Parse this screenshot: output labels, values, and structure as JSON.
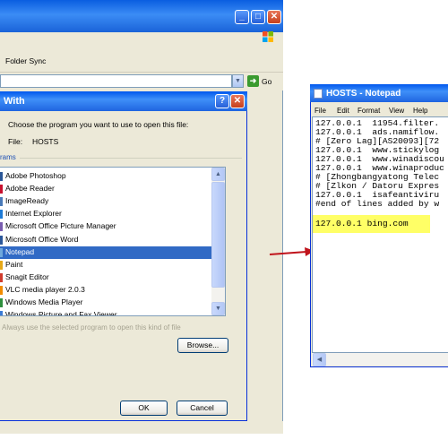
{
  "explorer": {
    "folder_sync_label": "Folder Sync",
    "go_label": "Go"
  },
  "open_with": {
    "title": "With",
    "help_glyph": "?",
    "close_glyph": "✕",
    "choose_text": "Choose the program you want to use to open this file:",
    "file_label": "File:",
    "file_name": "HOSTS",
    "programs_label": "rams",
    "programs": [
      {
        "label": "Adobe Photoshop",
        "icon": "photoshop-icon",
        "color": "#2b5797"
      },
      {
        "label": "Adobe Reader",
        "icon": "reader-icon",
        "color": "#c8102e"
      },
      {
        "label": "ImageReady",
        "icon": "imageready-icon",
        "color": "#4a7ab8"
      },
      {
        "label": "Internet Explorer",
        "icon": "ie-icon",
        "color": "#1e7bd6"
      },
      {
        "label": "Microsoft Office Picture Manager",
        "icon": "picture-manager-icon",
        "color": "#7a5db0"
      },
      {
        "label": "Microsoft Office Word",
        "icon": "word-icon",
        "color": "#2b579a"
      },
      {
        "label": "Notepad",
        "icon": "notepad-icon",
        "color": "#6fa8dc",
        "selected": true
      },
      {
        "label": "Paint",
        "icon": "paint-icon",
        "color": "#e6a817"
      },
      {
        "label": "Snagit Editor",
        "icon": "snagit-icon",
        "color": "#d03b2c"
      },
      {
        "label": "VLC media player 2.0.3",
        "icon": "vlc-icon",
        "color": "#f28c00"
      },
      {
        "label": "Windows Media Player",
        "icon": "media-player-icon",
        "color": "#2f8f3e"
      },
      {
        "label": "Windows Picture and Fax Viewer",
        "icon": "fax-viewer-icon",
        "color": "#3a7bd5"
      }
    ],
    "always_use_text": "Always use the selected program to open this kind of file",
    "browse_label": "Browse...",
    "ok_label": "OK",
    "cancel_label": "Cancel"
  },
  "notepad": {
    "title": "HOSTS - Notepad",
    "menu": [
      "File",
      "Edit",
      "Format",
      "View",
      "Help"
    ],
    "lines": [
      "127.0.0.1  11954.filter.",
      "127.0.0.1  ads.namiflow.",
      "# [Zero Lag][AS20093][72",
      "127.0.0.1  www.stickylog",
      "127.0.0.1  www.winadiscou",
      "127.0.0.1  www.winaproduc",
      "# [Zhongbangyatong Telec",
      "# [Zlkon / Datoru Expres",
      "127.0.0.1  isafeantiviru",
      "#end of lines added by w"
    ],
    "highlighted_line": "127.0.0.1 bing.com",
    "highlight_color": "#ffff66"
  },
  "arrow_color": "#c0141c"
}
